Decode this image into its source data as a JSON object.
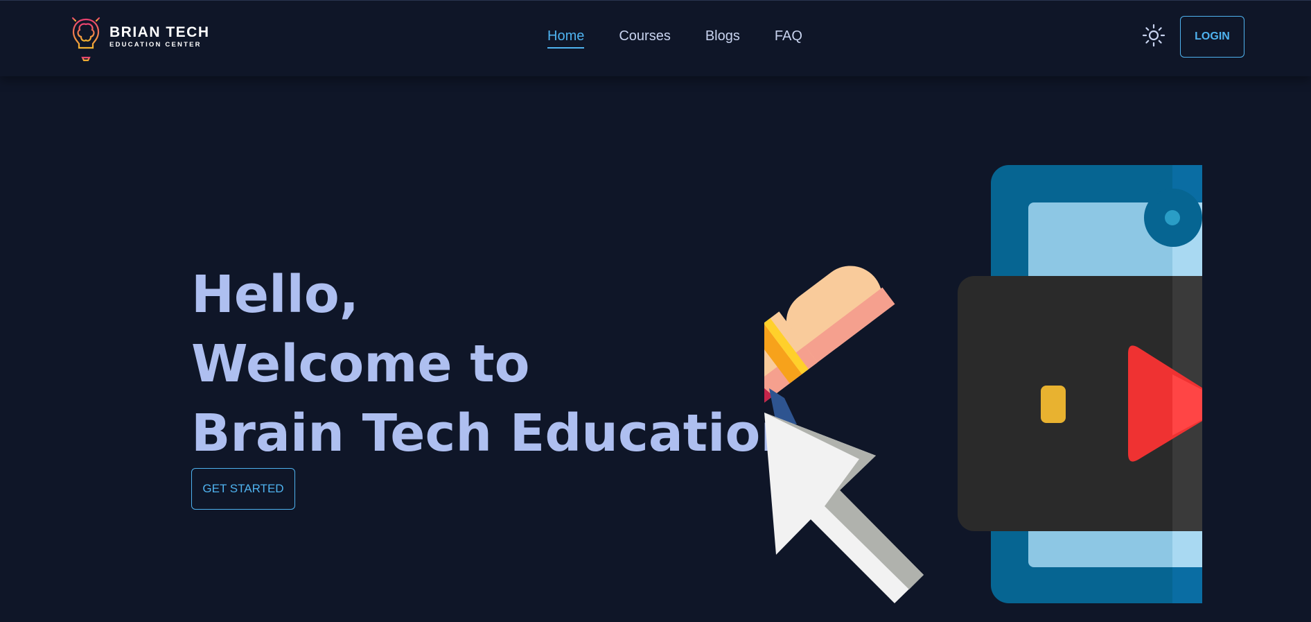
{
  "header": {
    "logo": {
      "title": "BRIAN TECH",
      "subtitle": "EDUCATION CENTER",
      "icon": "lightbulb-brain-icon"
    },
    "nav": [
      {
        "label": "Home",
        "active": true
      },
      {
        "label": "Courses",
        "active": false
      },
      {
        "label": "Blogs",
        "active": false
      },
      {
        "label": "FAQ",
        "active": false
      }
    ],
    "theme_toggle_icon": "sun-icon",
    "login_label": "LOGIN"
  },
  "hero": {
    "line1": "Hello,",
    "line2": "Welcome to",
    "line3": "Brain Tech Education",
    "cta_label": "GET STARTED",
    "illustration": "online-video-course-illustration"
  },
  "colors": {
    "background": "#0f1628",
    "accent": "#4fb3f0",
    "heading": "#aebff0",
    "nav_text": "#c8d3ef"
  }
}
